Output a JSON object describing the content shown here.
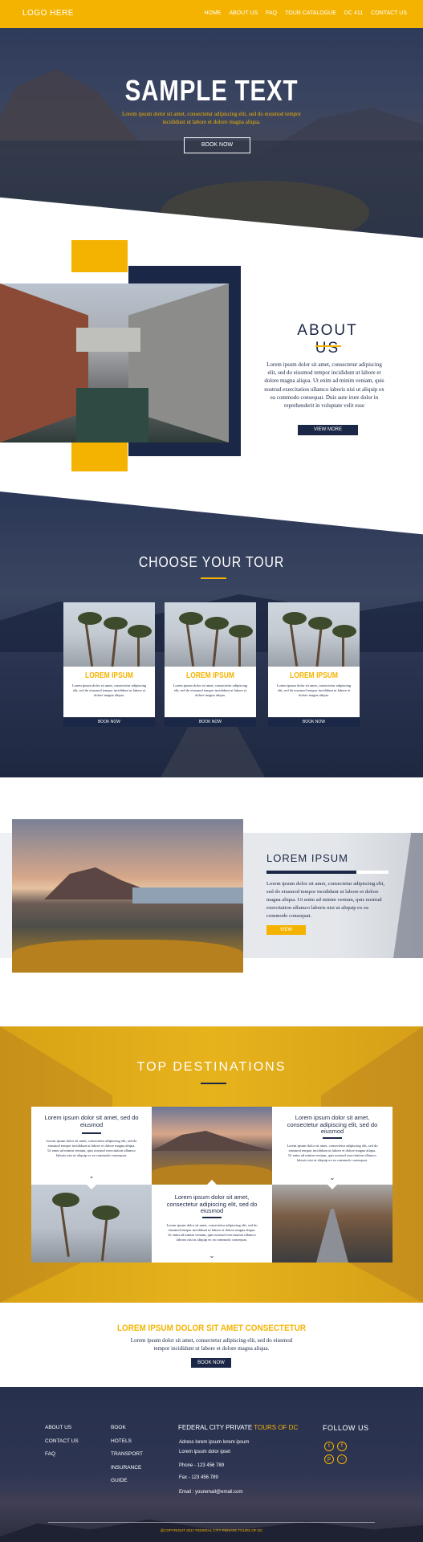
{
  "colors": {
    "accent": "#f5b301",
    "navy": "#1b2746",
    "white": "#ffffff"
  },
  "header": {
    "logo": "LOGO HERE",
    "nav": [
      "HOME",
      "ABOUT US",
      "FAQ",
      "TOUR CATALOGUE",
      "DC 411",
      "CONTACT US"
    ]
  },
  "hero": {
    "title": "SAMPLE TEXT",
    "text": "Lorem ipsum dolor sit amet, consectetur adipiscing elit, sed do eiusmod tempor incididunt ut labore et dolore magna aliqua.",
    "button": "BOOK NOW"
  },
  "about": {
    "title": "ABOUT US",
    "text": "Lorem ipsum dolor sit amet, consectetur adipiscing elit, sed do eiusmod tempor incididunt ut labore et dolore magna aliqua. Ut enim ad minim veniam, quis nostrud exercitation ullamco laboris nisi ut aliquip ex ea commodo consequat. Duis aute irure dolor in reprehenderit in voluptate velit esse",
    "button": "VIEW MORE"
  },
  "tours": {
    "title": "CHOOSE YOUR TOUR",
    "cards": [
      {
        "title": "LOREM IPSUM",
        "text": "Lorem ipsum dolor sit amet, consectetur adipiscing elit, sed do eiusmod tempor incididunt ut labore et dolore magna aliqua.",
        "button": "BOOK NOW"
      },
      {
        "title": "LOREM IPSUM",
        "text": "Lorem ipsum dolor sit amet, consectetur adipiscing elit, sed do eiusmod tempor incididunt ut labore et dolore magna aliqua.",
        "button": "BOOK NOW"
      },
      {
        "title": "LOREM IPSUM",
        "text": "Lorem ipsum dolor sit amet, consectetur adipiscing elit, sed do eiusmod tempor incididunt ut labore et dolore magna aliqua.",
        "button": "BOOK NOW"
      }
    ]
  },
  "feature": {
    "title": "LOREM IPSUM",
    "text": "Lorem ipsum dolor sit amet, consectetur adipiscing elit, sed do eiusmod tempor incididunt ut labore et dolore magna aliqua. Ut enim ad minim veniam, quis nostrud exercitation ullamco laboris nisi ut aliquip ex ea commodo consequat.",
    "button": "VIEW"
  },
  "destinations": {
    "title": "TOP  DESTINATIONS",
    "tiles": [
      {
        "title": "Lorem ipsum dolor sit amet, sed do eiusmod",
        "text": "Lorem ipsum dolor sit amet, consectetur adipiscing elit, sed do eiusmod tempor incididunt ut labore et dolore magna aliqua. Ut enim ad minim veniam, quis nostrud exercitation ullamco laboris nisi ut aliquip ex ea commodo consequat."
      },
      {
        "title": "Lorem ipsum dolor sit amet, consectetur adipiscing elit, sed do eiusmod",
        "text": "Lorem ipsum dolor sit amet, consectetur adipiscing elit, sed do eiusmod tempor incididunt ut labore et dolore magna aliqua. Ut enim ad minim veniam, quis nostrud exercitation ullamco laboris nisi ut aliquip ex ea commodo consequat."
      },
      {
        "title": "Lorem ipsum dolor sit amet, consectetur adipiscing elit, sed do eiusmod",
        "text": "Lorem ipsum dolor sit amet, consectetur adipiscing elit, sed do eiusmod tempor incididunt ut labore et dolore magna aliqua. Ut enim ad minim veniam, quis nostrud exercitation ullamco laboris nisi ut aliquip ex ea commodo consequat."
      }
    ]
  },
  "cta": {
    "title": "LOREM IPSUM DOLOR SIT AMET CONSECTETUR",
    "text": "Lorem ipsum dolor sit amet, consectetur adipiscing elit, sed do eiusmod tempor incididunt ut labore et dolore magna aliqua.",
    "button": "BOOK NOW"
  },
  "footer": {
    "col1": [
      "ABOUT US",
      "CONTACT US",
      "FAQ"
    ],
    "col2": [
      "BOOK",
      "HOTELS",
      "TRANSPORT",
      "INSURANCE",
      "GUIDE"
    ],
    "brand": "FEDERAL CITY PRIVATE",
    "brand_highlight": "TOURS OF DC",
    "address1": "Adress lorem ipsum lorem ipsum",
    "address2": "Lorem ipsum dolor ipset",
    "phone": "Phone - 123 456 789",
    "fax": "Fax - 123 456 789",
    "email": "Email : youremail@email.com",
    "follow": "FOLLOW US",
    "social_icons": [
      "twitter-icon",
      "facebook-icon",
      "pinterest-icon",
      "instagram-icon"
    ],
    "copyright": "@COPYRIGHT 2017 FEDERAL CITY PRIVATE TOURS OF DC"
  }
}
